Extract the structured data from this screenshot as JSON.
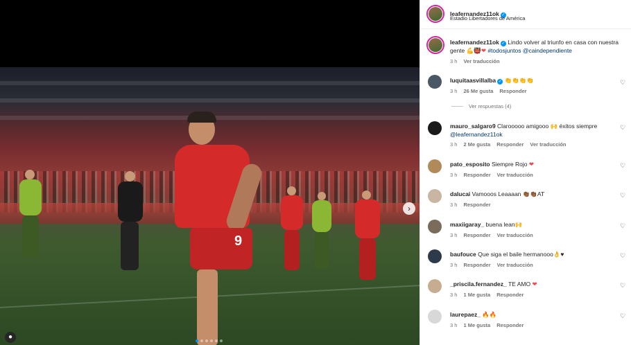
{
  "post": {
    "author": "leafernandez11ok",
    "location": "Estadio Libertadores de América",
    "caption_author": "leafernandez11ok",
    "caption_line1": "Lindo volver al triunfo en casa con nuestra",
    "caption_line2_start": "gente ",
    "caption_emojis": "💪👹",
    "caption_heart": "❤",
    "caption_hashtag": "#todosjuntos",
    "caption_mention": "@caindependiente",
    "caption_time": "3 h",
    "see_translation": "Ver traducción"
  },
  "media": {
    "carousel_dot_count": 6,
    "carousel_active_index": 0,
    "next_icon": "chevron-right-icon",
    "tag_icon": "user-tag-icon",
    "shirt_number": "9"
  },
  "comments": [
    {
      "user": "luquitaasvillalba",
      "verified": true,
      "text": "👏👏👏👏",
      "time": "3 h",
      "likes": "26 Me gusta",
      "reply": "Responder",
      "translate": ""
    },
    {
      "user": "mauro_salgaro9",
      "verified": false,
      "text": "Clarooooo amigooo 🙌 éxitos siempre",
      "mention": "@leafernandez11ok",
      "time": "3 h",
      "likes": "2 Me gusta",
      "reply": "Responder",
      "translate": "Ver traducción"
    },
    {
      "user": "pato_esposito",
      "verified": false,
      "text": "Siempre Rojo",
      "heart": "❤",
      "time": "3 h",
      "likes": "",
      "reply": "Responder",
      "translate": "Ver traducción"
    },
    {
      "user": "dalucai",
      "verified": false,
      "text": "Vamooos Leaaaan 👏🏾👏🏾AT",
      "time": "3 h",
      "likes": "",
      "reply": "Responder",
      "translate": ""
    },
    {
      "user": "maxiigaray_",
      "verified": false,
      "text": "buena lean🙌",
      "time": "3 h",
      "likes": "",
      "reply": "Responder",
      "translate": "Ver traducción"
    },
    {
      "user": "baufouce",
      "verified": false,
      "text": "Que siga el baile hermanooo👌♥",
      "time": "3 h",
      "likes": "",
      "reply": "Responder",
      "translate": "Ver traducción"
    },
    {
      "user": "_priscila.fernandez_",
      "verified": false,
      "text": "TE AMO",
      "heart": "❤",
      "time": "3 h",
      "likes": "1 Me gusta",
      "reply": "Responder",
      "translate": ""
    },
    {
      "user": "laurepaez_",
      "verified": false,
      "text": "🔥🔥",
      "time": "3 h",
      "likes": "1 Me gusta",
      "reply": "Responder",
      "translate": ""
    }
  ],
  "view_replies": "Ver respuestas (4)",
  "colors": {
    "accent_blue": "#0095f6",
    "link_blue": "#00376b",
    "heart_red": "#ed4956",
    "jersey_red": "#d42a2a",
    "opponent_green": "#8ab834"
  }
}
